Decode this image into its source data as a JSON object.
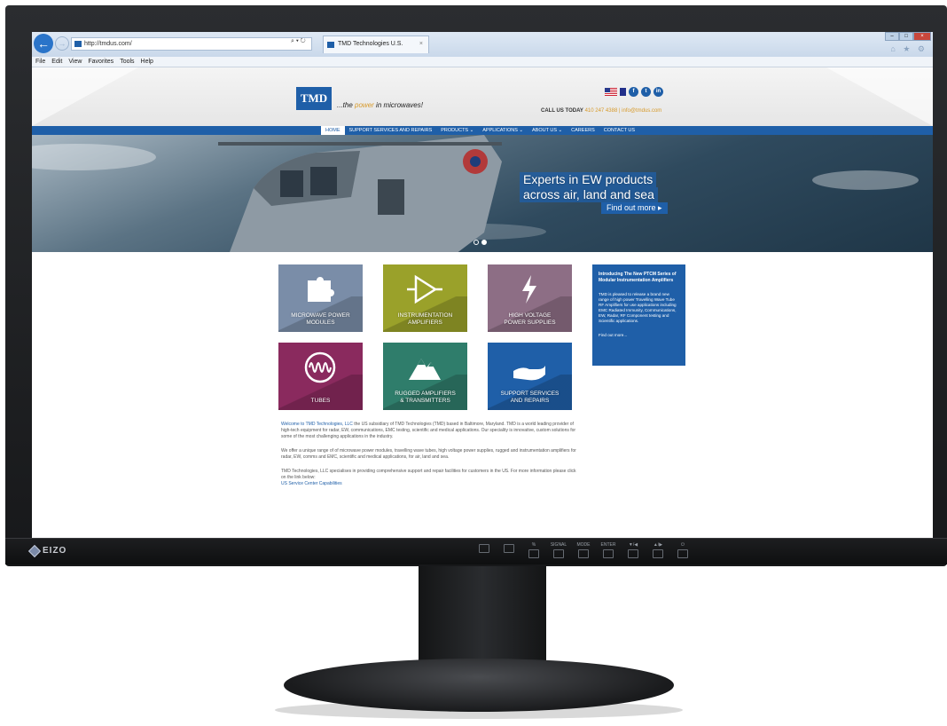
{
  "browser": {
    "url": "http://tmdus.com/",
    "search_icons": "⌕ ▾ ↻",
    "tab_title": "TMD Technologies U.S.",
    "tab_close": "×",
    "window_controls": [
      "–",
      "□",
      "×"
    ],
    "toolbar_icons": "⌂ ★ ⚙",
    "menu": [
      "File",
      "Edit",
      "View",
      "Favorites",
      "Tools",
      "Help"
    ]
  },
  "site": {
    "logo": "TMD",
    "tagline_pre": "...the ",
    "tagline_hl": "power",
    "tagline_post": " in microwaves!",
    "call_label": "CALL US TODAY",
    "contact": "410 247 4388 | info@tmdus.com",
    "social": [
      "f",
      "t",
      "in"
    ],
    "nav": [
      "HOME",
      "SUPPORT SERVICES AND REPAIRS",
      "PRODUCTS ⌄",
      "APPLICATIONS ⌄",
      "ABOUT US ⌄",
      "CAREERS",
      "CONTACT US"
    ],
    "hero_title_1": "Experts in EW products",
    "hero_title_2": "across air, land and sea",
    "hero_cta": "Find out more ▸",
    "tiles": [
      {
        "line1": "MICROWAVE POWER",
        "line2": "MODULES",
        "color": "#7a8da8"
      },
      {
        "line1": "INSTRUMENTATION",
        "line2": "AMPLIFIERS",
        "color": "#9aa12a"
      },
      {
        "line1": "HIGH VOLTAGE",
        "line2": "POWER SUPPLIES",
        "color": "#8d6e85"
      },
      {
        "line1": "TUBES",
        "line2": "",
        "color": "#8a2a5e"
      },
      {
        "line1": "RUGGED AMPLIFIERS",
        "line2": "& TRANSMITTERS",
        "color": "#2f7d6b"
      },
      {
        "line1": "SUPPORT SERVICES",
        "line2": "AND REPAIRS",
        "color": "#1f5fa8"
      }
    ],
    "news_title": "Introducing The New PTCM Series of Modular Instrumentation Amplifiers",
    "news_body": "TMD is pleased to release a brand new range of high power Travelling Wave Tube RF Amplifiers for use applications including EMC Radiated Immunity, Communications, EW, Radar, RF Component testing and Scientific applications.",
    "news_link": "Find out more...",
    "p1_link": "Welcome to TMD Technologies, LLC",
    "p1": " the US subsidiary of TMD Technologies (TMD) based in Baltimore, Maryland. TMD is a world leading provider of high-tech equipment for radar, EW, communications, EMC testing, scientific and medical applications. Our speciality is innovative, custom solutions for some of the most challenging applications in the industry.",
    "p2": "We offer a unique range of of microwave power modules, travelling wave tubes, high voltage power supplies, rugged and instrumentation amplifiers for radar, EW, comms and EMC, scientific and medical applications, for air, land and sea.",
    "p3": "TMD Technologies, LLC specialises in providing comprehensive support and repair facilities for customers in the US. For more information please click on the link below:",
    "p3_link": "US Service Center Capabilities"
  },
  "monitor": {
    "brand": "EIZO",
    "buttons": [
      "%",
      "SIGNAL",
      "MODE",
      "ENTER",
      "▼/◀",
      "▲/▶",
      "⏻"
    ]
  }
}
